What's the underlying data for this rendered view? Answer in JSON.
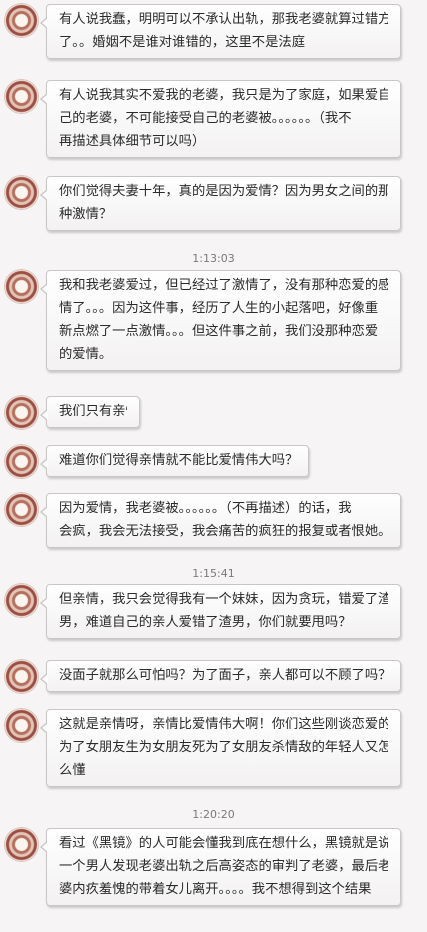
{
  "messages": [
    {
      "lines": [
        "有人说我蠢，明明可以不承认出轨，那我老婆就算过错方",
        "了。。婚姻不是谁对谁错的，这里不是法庭"
      ]
    },
    {
      "lines": [
        "有人说我其实不爱我的老婆，我只是为了家庭，如果爱自",
        "己的老婆，不可能接受自己的老婆被。。。。。。（我不",
        "再描述具体细节可以吗）"
      ]
    },
    {
      "lines": [
        "你们觉得夫妻十年，真的是因为爱情？因为男女之间的那",
        "种激情？"
      ]
    },
    {
      "lines": [
        "我和我老婆爱过，但已经过了激情了，没有那种恋爱的感",
        "情了。。。因为这件事，经历了人生的小起落吧，好像重",
        "新点燃了一点激情。。。但这件事之前，我们没那种恋爱",
        "的爱情。"
      ]
    },
    {
      "lines": [
        "我们只有亲情"
      ]
    },
    {
      "lines": [
        "难道你们觉得亲情就不能比爱情伟大吗？"
      ]
    },
    {
      "lines": [
        "因为爱情，我老婆被。。。。。。（不再描述）的话，我",
        "会疯，我会无法接受，我会痛苦的疯狂的报复或者恨她。"
      ]
    },
    {
      "lines": [
        "但亲情，我只会觉得我有一个妹妹，因为贪玩，错爱了渣",
        "男，难道自己的亲人爱错了渣男，你们就要甩吗？"
      ]
    },
    {
      "lines": [
        "没面子就那么可怕吗？为了面子，亲人都可以不顾了吗？"
      ]
    },
    {
      "lines": [
        "这就是亲情呀，亲情比爱情伟大啊！你们这些刚谈恋爱的",
        "为了女朋友生为女朋友死为了女朋友杀情敌的年轻人又怎",
        "么懂"
      ]
    },
    {
      "lines": [
        "看过《黑镜》的人可能会懂我到底在想什么，黑镜就是说",
        "一个男人发现老婆出轨之后高姿态的审判了老婆，最后老",
        "婆内疚羞愧的带着女儿离开。。。。我不想得到这个结果"
      ]
    }
  ],
  "timestamps": [
    "1:13:03",
    "1:15:41",
    "1:20:20"
  ]
}
